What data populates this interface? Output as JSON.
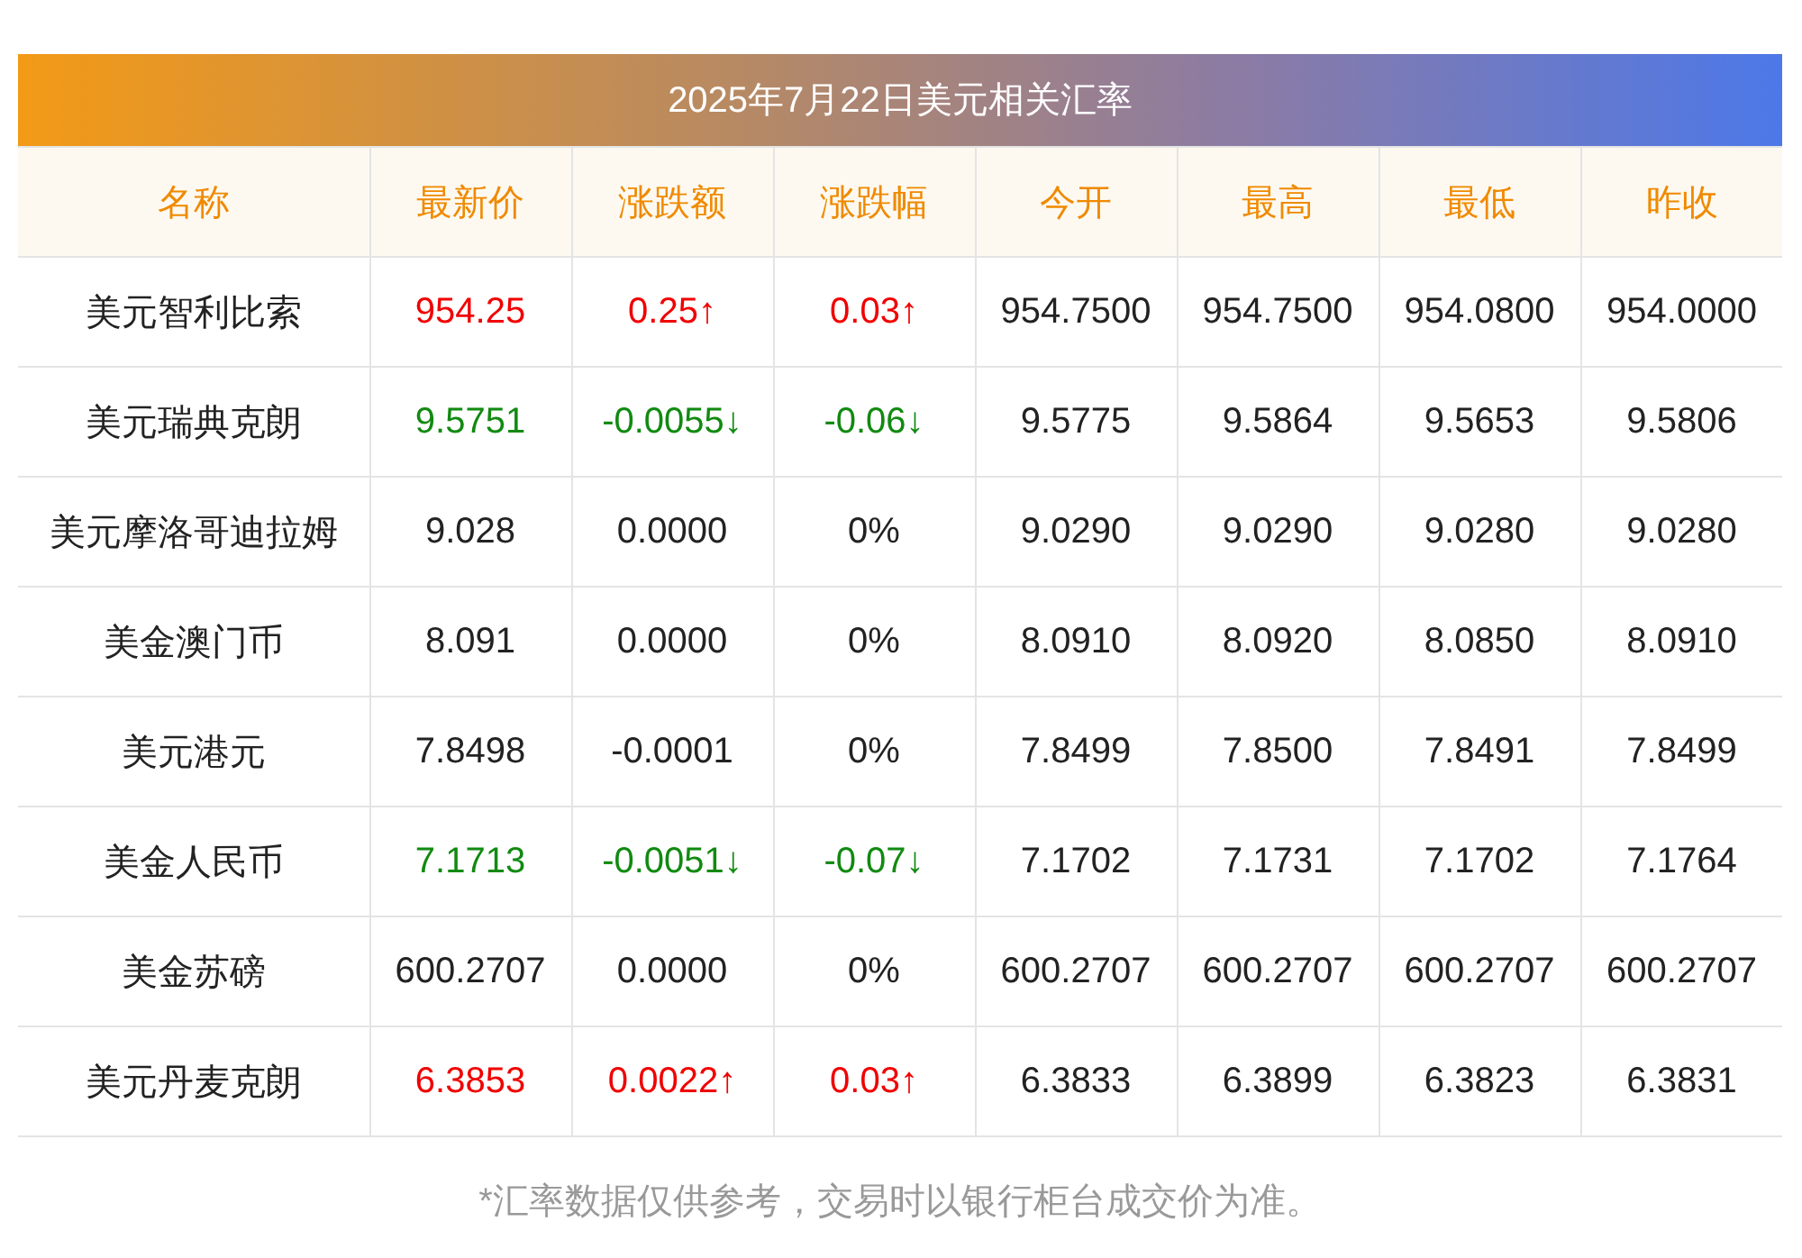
{
  "title": "2025年7月22日美元相关汇率",
  "columns": [
    "名称",
    "最新价",
    "涨跌额",
    "涨跌幅",
    "今开",
    "最高",
    "最低",
    "昨收"
  ],
  "rows": [
    {
      "name": "美元智利比索",
      "color": "#f00000",
      "price": "954.25",
      "change": "0.25↑",
      "pct": "0.03↑",
      "open": "954.7500",
      "high": "954.7500",
      "low": "954.0800",
      "prev": "954.0000"
    },
    {
      "name": "美元瑞典克朗",
      "color": "#118a11",
      "price": "9.5751",
      "change": "-0.0055↓",
      "pct": "-0.06↓",
      "open": "9.5775",
      "high": "9.5864",
      "low": "9.5653",
      "prev": "9.5806"
    },
    {
      "name": "美元摩洛哥迪拉姆",
      "color": "#222222",
      "price": "9.028",
      "change": "0.0000",
      "pct": "0%",
      "open": "9.0290",
      "high": "9.0290",
      "low": "9.0280",
      "prev": "9.0280"
    },
    {
      "name": "美金澳门币",
      "color": "#222222",
      "price": "8.091",
      "change": "0.0000",
      "pct": "0%",
      "open": "8.0910",
      "high": "8.0920",
      "low": "8.0850",
      "prev": "8.0910"
    },
    {
      "name": "美元港元",
      "color": "#222222",
      "price": "7.8498",
      "change": "-0.0001",
      "pct": "0%",
      "open": "7.8499",
      "high": "7.8500",
      "low": "7.8491",
      "prev": "7.8499"
    },
    {
      "name": "美金人民币",
      "color": "#118a11",
      "price": "7.1713",
      "change": "-0.0051↓",
      "pct": "-0.07↓",
      "open": "7.1702",
      "high": "7.1731",
      "low": "7.1702",
      "prev": "7.1764"
    },
    {
      "name": "美金苏磅",
      "color": "#222222",
      "price": "600.2707",
      "change": "0.0000",
      "pct": "0%",
      "open": "600.2707",
      "high": "600.2707",
      "low": "600.2707",
      "prev": "600.2707"
    },
    {
      "name": "美元丹麦克朗",
      "color": "#f00000",
      "price": "6.3853",
      "change": "0.0022↑",
      "pct": "0.03↑",
      "open": "6.3833",
      "high": "6.3899",
      "low": "6.3823",
      "prev": "6.3831"
    }
  ],
  "note": "*汇率数据仅供参考，交易时以银行柜台成交价为准。"
}
